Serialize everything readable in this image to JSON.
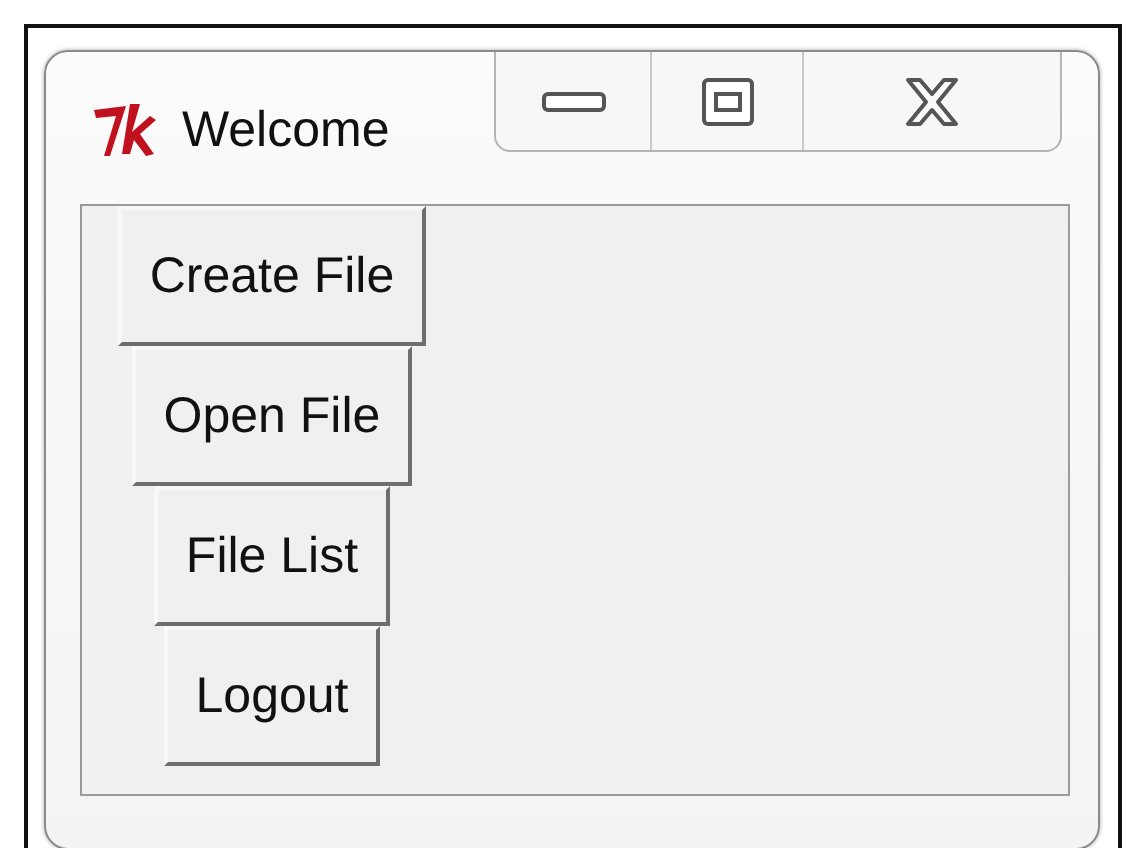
{
  "window": {
    "title": "Welcome"
  },
  "buttons": [
    {
      "label": "Create File"
    },
    {
      "label": "Open File"
    },
    {
      "label": "File List"
    },
    {
      "label": "Logout"
    }
  ]
}
